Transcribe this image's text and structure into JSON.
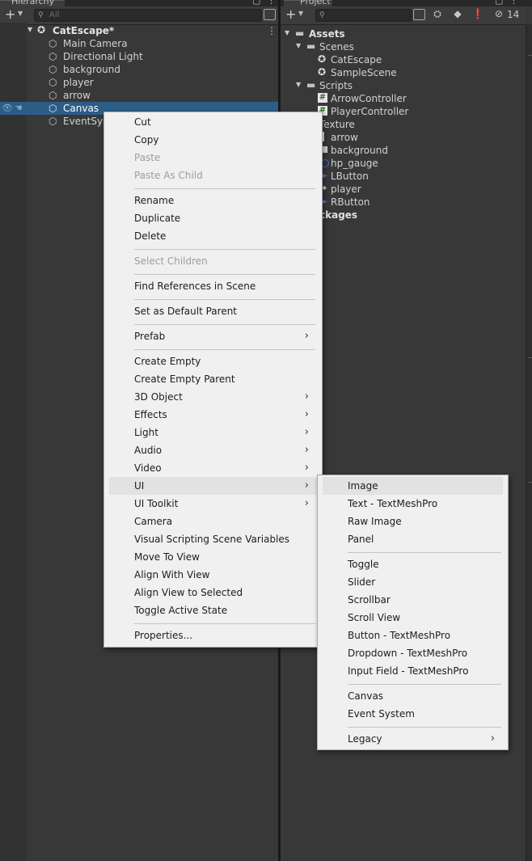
{
  "hierarchy": {
    "tab_label": "Hierarchy",
    "search_placeholder": "All",
    "scene_name": "CatEscape*",
    "items": [
      "Main Camera",
      "Directional Light",
      "background",
      "player",
      "arrow",
      "Canvas",
      "EventSys"
    ]
  },
  "project": {
    "tab_label": "Project",
    "hidden_count": "14",
    "tree": [
      {
        "label": "Assets",
        "bold": true
      },
      {
        "label": "Scenes"
      },
      {
        "label": "CatEscape"
      },
      {
        "label": "SampleScene"
      },
      {
        "label": "Scripts"
      },
      {
        "label": "ArrowController"
      },
      {
        "label": "PlayerController"
      },
      {
        "label": "Texture"
      },
      {
        "label": "arrow"
      },
      {
        "label": "background"
      },
      {
        "label": "hp_gauge"
      },
      {
        "label": "LButton"
      },
      {
        "label": "player"
      },
      {
        "label": "RButton"
      },
      {
        "label": "ckages",
        "bold": true
      }
    ]
  },
  "context_menu": {
    "items": [
      "Cut",
      "Copy",
      "Paste",
      "Paste As Child",
      "Rename",
      "Duplicate",
      "Delete",
      "Select Children",
      "Find References in Scene",
      "Set as Default Parent",
      "Prefab",
      "Create Empty",
      "Create Empty Parent",
      "3D Object",
      "Effects",
      "Light",
      "Audio",
      "Video",
      "UI",
      "UI Toolkit",
      "Camera",
      "Visual Scripting Scene Variables",
      "Move To View",
      "Align With View",
      "Align View to Selected",
      "Toggle Active State",
      "Properties..."
    ]
  },
  "ui_submenu": {
    "items": [
      "Image",
      "Text - TextMeshPro",
      "Raw Image",
      "Panel",
      "Toggle",
      "Slider",
      "Scrollbar",
      "Scroll View",
      "Button - TextMeshPro",
      "Dropdown - TextMeshPro",
      "Input Field - TextMeshPro",
      "Canvas",
      "Event System",
      "Legacy"
    ]
  },
  "colors": {
    "panel_bg": "#383838",
    "selection": "#2c5d87",
    "menu_bg": "#f0f0f0"
  }
}
